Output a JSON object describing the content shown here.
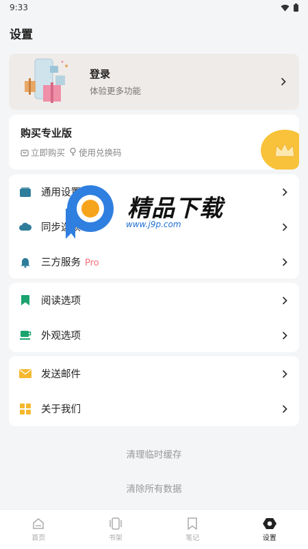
{
  "status_bar": {
    "time": "9:33"
  },
  "page": {
    "title": "设置"
  },
  "login": {
    "title": "登录",
    "subtitle": "体验更多功能"
  },
  "pro": {
    "title": "购买专业版",
    "buy_now": "立即购买",
    "redeem": "使用兑换码"
  },
  "groups": [
    {
      "items": [
        {
          "label": "通用设置",
          "icon": "folder-icon",
          "color": "#2e7d9a"
        },
        {
          "label": "同步选项",
          "icon": "cloud-icon",
          "color": "#2e7d9a"
        },
        {
          "label": "三方服务",
          "tag": "Pro",
          "icon": "bell-icon",
          "color": "#2e7d9a"
        }
      ]
    },
    {
      "items": [
        {
          "label": "阅读选项",
          "icon": "bookmark-icon",
          "color": "#1aa36f"
        },
        {
          "label": "外观选项",
          "icon": "cup-icon",
          "color": "#1aa36f"
        }
      ]
    },
    {
      "items": [
        {
          "label": "发送邮件",
          "icon": "mail-icon",
          "color": "#f5b82e"
        },
        {
          "label": "关于我们",
          "icon": "grid-icon",
          "color": "#f5b82e"
        }
      ]
    }
  ],
  "actions": {
    "clear_cache": "清理临时缓存",
    "clear_all": "清除所有数据"
  },
  "nav": [
    {
      "label": "首页",
      "icon": "home-icon"
    },
    {
      "label": "书架",
      "icon": "bookshelf-icon"
    },
    {
      "label": "笔记",
      "icon": "bookmark-icon"
    },
    {
      "label": "设置",
      "icon": "gear-icon",
      "active": true
    }
  ],
  "watermark": {
    "brand": "精品下载",
    "url": "www.j9p.com"
  },
  "colors": {
    "accent_blue": "#2e7d9a",
    "accent_green": "#1aa36f",
    "accent_yellow": "#f5b82e",
    "pro_tag": "#f06f7b"
  }
}
